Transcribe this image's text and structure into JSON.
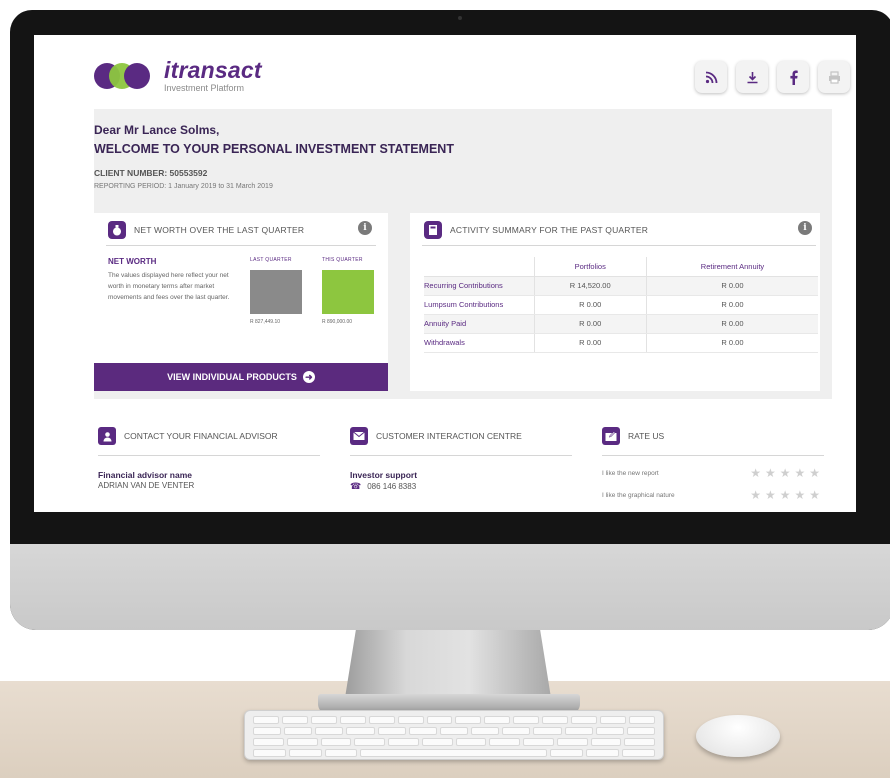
{
  "logo": {
    "brand": "itransact",
    "tagline": "Investment Platform"
  },
  "toolbar": {
    "icons": [
      "rss-icon",
      "download-icon",
      "facebook-icon",
      "print-icon"
    ],
    "glyphs": [
      "))",
      "⤓",
      "f",
      "⎙"
    ]
  },
  "welcome": {
    "greeting": "Dear Mr Lance Solms,",
    "title": "WELCOME TO YOUR PERSONAL INVESTMENT STATEMENT",
    "client_number": "CLIENT NUMBER: 50553592",
    "reporting_period": "REPORTING PERIOD: 1 January 2019 to 31 March 2019"
  },
  "net_worth": {
    "heading": "NET WORTH OVER THE LAST QUARTER",
    "title": "NET WORTH",
    "description": "The values displayed here reflect your net worth in monetary terms after market movements and fees over the last quarter.",
    "last_quarter_label": "LAST QUARTER",
    "this_quarter_label": "THIS QUARTER",
    "last_quarter_value": "R 827,449.10",
    "this_quarter_value": "R 890,000.00",
    "button_label": "VIEW INDIVIDUAL PRODUCTS"
  },
  "activity": {
    "heading": "ACTIVITY SUMMARY FOR THE PAST QUARTER",
    "columns": [
      "",
      "Portfolios",
      "Retirement Annuity"
    ],
    "rows": [
      {
        "label": "Recurring Contributions",
        "portfolios": "R 14,520.00",
        "annuity": "R 0.00"
      },
      {
        "label": "Lumpsum Contributions",
        "portfolios": "R 0.00",
        "annuity": "R 0.00"
      },
      {
        "label": "Annuity Paid",
        "portfolios": "R 0.00",
        "annuity": "R 0.00"
      },
      {
        "label": "Withdrawals",
        "portfolios": "R 0.00",
        "annuity": "R 0.00"
      }
    ]
  },
  "contact": {
    "heading": "CONTACT YOUR FINANCIAL ADVISOR",
    "label": "Financial advisor name",
    "name": "ADRIAN VAN DE VENTER"
  },
  "customer": {
    "heading": "CUSTOMER INTERACTION CENTRE",
    "label": "Investor support",
    "phone": "086 146 8383"
  },
  "rate": {
    "heading": "RATE US",
    "items": [
      "I like the new report",
      "I like the graphical nature"
    ]
  },
  "colors": {
    "accent": "#5a2a82",
    "green": "#8dc63f",
    "gray_bar": "#8a8a8a"
  }
}
